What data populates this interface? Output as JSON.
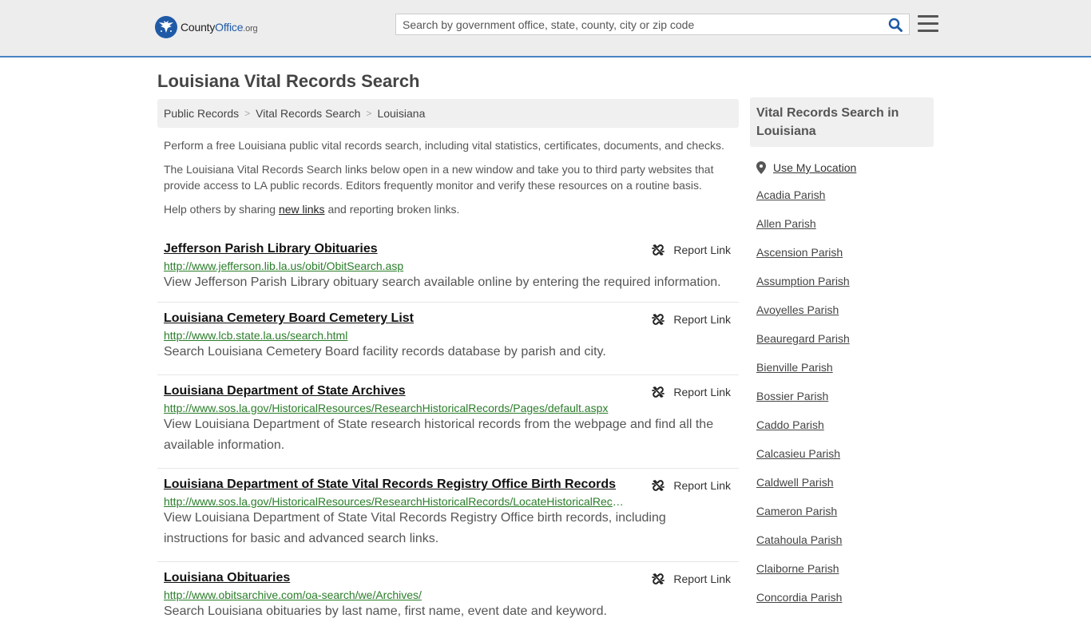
{
  "header": {
    "logo": {
      "county": "County",
      "office": "Office",
      "org": ".org"
    },
    "search": {
      "placeholder": "Search by government office, state, county, city or zip code"
    },
    "icons": {
      "search": "search-icon",
      "menu": "hamburger-menu-icon"
    }
  },
  "page": {
    "title": "Louisiana Vital Records Search",
    "breadcrumb": [
      "Public Records",
      "Vital Records Search",
      "Louisiana"
    ],
    "intro1": "Perform a free Louisiana public vital records search, including vital statistics, certificates, documents, and checks.",
    "intro2": "The Louisiana Vital Records Search links below open in a new window and take you to third party websites that provide access to LA public records. Editors frequently monitor and verify these resources on a routine basis.",
    "intro3_pre": "Help others by sharing ",
    "intro3_link": "new links",
    "intro3_post": " and reporting broken links.",
    "report_label": "Report Link",
    "entries": [
      {
        "title": "Jefferson Parish Library Obituaries",
        "url": "http://www.jefferson.lib.la.us/obit/ObitSearch.asp",
        "desc": "View Jefferson Parish Library obituary search available online by entering the required information."
      },
      {
        "title": "Louisiana Cemetery Board Cemetery List",
        "url": "http://www.lcb.state.la.us/search.html",
        "desc": "Search Louisiana Cemetery Board facility records database by parish and city."
      },
      {
        "title": "Louisiana Department of State Archives",
        "url": "http://www.sos.la.gov/HistoricalResources/ResearchHistoricalRecords/Pages/default.aspx",
        "desc": "View Louisiana Department of State research historical records from the webpage and find all the available information."
      },
      {
        "title": "Louisiana Department of State Vital Records Registry Office Birth Records",
        "url": "http://www.sos.la.gov/HistoricalResources/ResearchHistoricalRecords/LocateHistoricalRecords",
        "desc": "View Louisiana Department of State Vital Records Registry Office birth records, including instructions for basic and advanced search links."
      },
      {
        "title": "Louisiana Obituaries",
        "url": "http://www.obitsarchive.com/oa-search/we/Archives/",
        "desc": "Search Louisiana obituaries by last name, first name, event date and keyword."
      }
    ]
  },
  "sidebar": {
    "title": "Vital Records Search in Louisiana",
    "use_location": "Use My Location",
    "parishes": [
      "Acadia Parish",
      "Allen Parish",
      "Ascension Parish",
      "Assumption Parish",
      "Avoyelles Parish",
      "Beauregard Parish",
      "Bienville Parish",
      "Bossier Parish",
      "Caddo Parish",
      "Calcasieu Parish",
      "Caldwell Parish",
      "Cameron Parish",
      "Catahoula Parish",
      "Claiborne Parish",
      "Concordia Parish"
    ]
  },
  "colors": {
    "accent": "#4a84c4",
    "link_green": "#2a7d2a",
    "logo_blue": "#1f5aa6"
  }
}
